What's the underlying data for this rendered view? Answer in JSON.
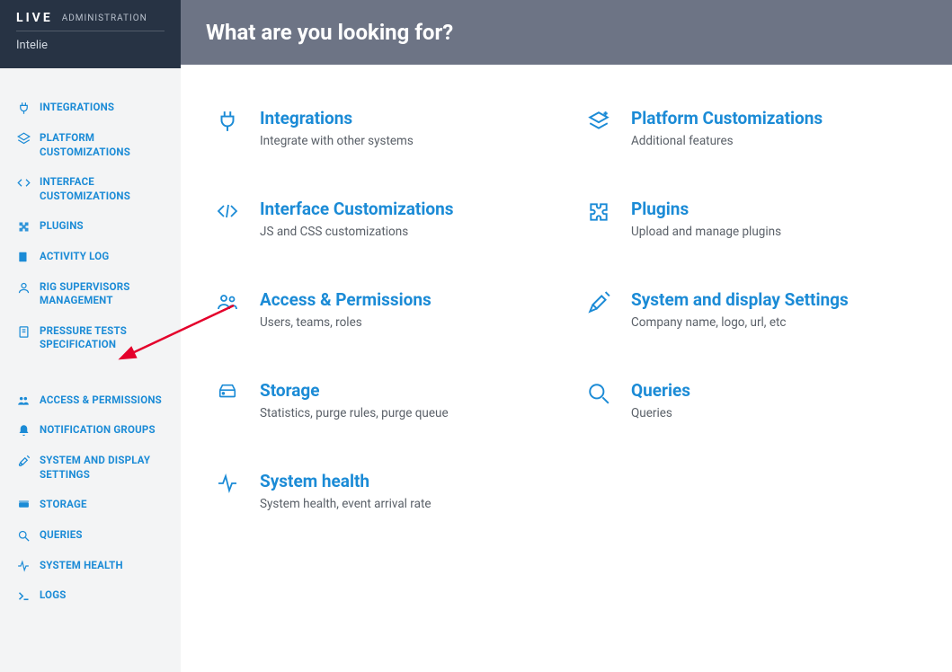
{
  "brand": {
    "logo": "LIVE",
    "section": "ADMINISTRATION",
    "tenant": "Intelie"
  },
  "sidebar": {
    "group1": [
      {
        "label": "Integrations"
      },
      {
        "label": "Platform Customizations"
      },
      {
        "label": "Interface Customizations"
      },
      {
        "label": "Plugins"
      },
      {
        "label": "Activity Log"
      },
      {
        "label": "Rig Supervisors Management"
      },
      {
        "label": "Pressure Tests Specification"
      }
    ],
    "group2": [
      {
        "label": "Access & Permissions"
      },
      {
        "label": "Notification Groups"
      },
      {
        "label": "System and Display Settings"
      },
      {
        "label": "Storage"
      },
      {
        "label": "Queries"
      },
      {
        "label": "System Health"
      },
      {
        "label": "Logs"
      }
    ]
  },
  "topbar": {
    "title": "What are you looking for?"
  },
  "cards": [
    {
      "title": "Integrations",
      "desc": "Integrate with other systems"
    },
    {
      "title": "Platform Customizations",
      "desc": "Additional features"
    },
    {
      "title": "Interface Customizations",
      "desc": "JS and CSS customizations"
    },
    {
      "title": "Plugins",
      "desc": "Upload and manage plugins"
    },
    {
      "title": "Access & Permissions",
      "desc": "Users, teams, roles"
    },
    {
      "title": "System and display Settings",
      "desc": "Company name, logo, url, etc"
    },
    {
      "title": "Storage",
      "desc": "Statistics, purge rules, purge queue"
    },
    {
      "title": "Queries",
      "desc": "Queries"
    },
    {
      "title": "System health",
      "desc": "System health, event arrival rate"
    }
  ]
}
